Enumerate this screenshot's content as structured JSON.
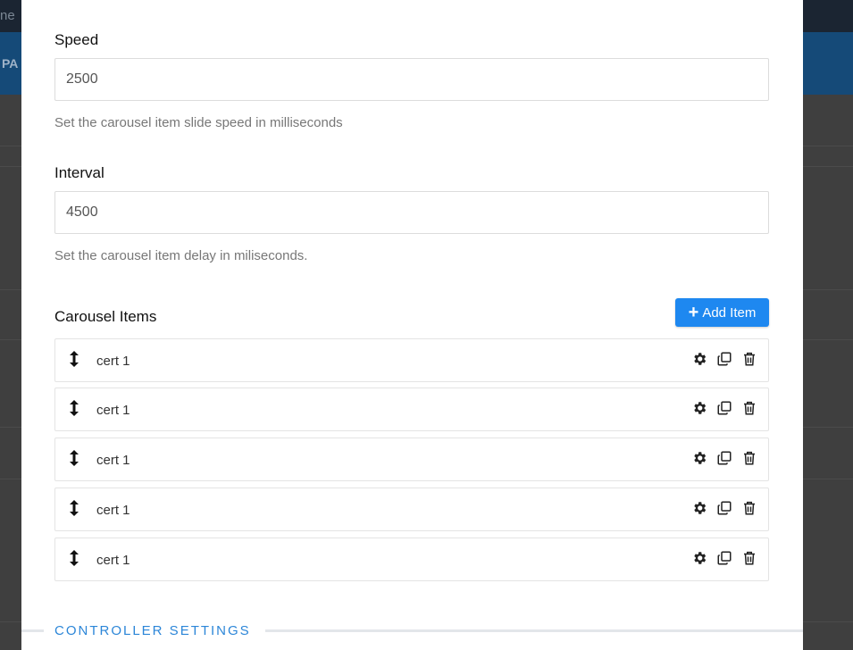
{
  "background": {
    "topbar_fragment": "ne",
    "bluebar_fragment": "PA"
  },
  "fields": {
    "speed": {
      "label": "Speed",
      "value": "2500",
      "help": "Set the carousel item slide speed in milliseconds"
    },
    "interval": {
      "label": "Interval",
      "value": "4500",
      "help": "Set the carousel item delay in miliseconds."
    }
  },
  "carousel": {
    "title": "Carousel Items",
    "add_button_label": "Add Item",
    "items": [
      {
        "label": "cert 1"
      },
      {
        "label": "cert 1"
      },
      {
        "label": "cert 1"
      },
      {
        "label": "cert 1"
      },
      {
        "label": "cert 1"
      }
    ],
    "item_icons": [
      "drag-handle-icon",
      "gear-icon",
      "copy-icon",
      "trash-icon"
    ]
  },
  "section": {
    "title": "CONTROLLER SETTINGS"
  },
  "colors": {
    "accent": "#1e88f0",
    "section_title": "#2c86d8"
  }
}
